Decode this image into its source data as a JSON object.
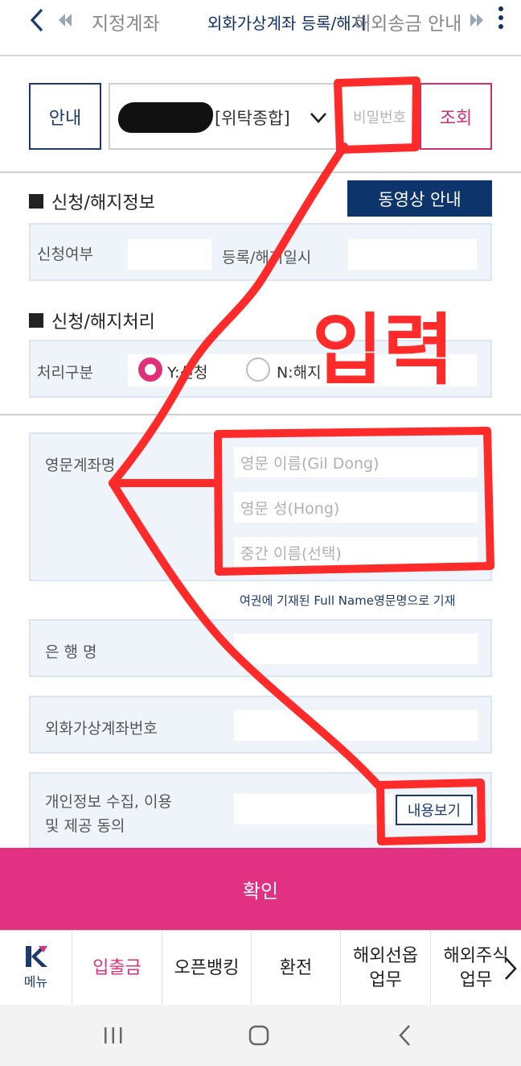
{
  "topnav": {
    "tabs": [
      {
        "label": "지정계좌"
      },
      {
        "label": "외화가상계좌 등록/해지"
      },
      {
        "label": "해외송금 안내"
      }
    ]
  },
  "account": {
    "info_label": "안내",
    "account_type": "[위탁종합]",
    "password_placeholder": "비밀번호",
    "query_label": "조회"
  },
  "section1": {
    "title": "신청/해지정보",
    "video_label": "동영상 안내",
    "apply_label": "신청여부",
    "datetime_label": "등록/해지일시"
  },
  "section2": {
    "title": "신청/해지처리",
    "process_label": "처리구분",
    "options": [
      {
        "label": "Y:신청",
        "selected": true
      },
      {
        "label": "N:해지",
        "selected": false
      }
    ]
  },
  "form": {
    "eng_name_label": "영문계좌명",
    "first_name_placeholder": "영문 이름(Gil Dong)",
    "last_name_placeholder": "영문 성(Hong)",
    "middle_name_placeholder": "중간 이름(선택)",
    "note": "여권에 기재된 Full Name영문명으로 기재",
    "bank_label": "은 행 명",
    "virtual_account_label": "외화가상계좌번호",
    "consent_label_line1": "개인정보 수집, 이용",
    "consent_label_line2": "및 제공 동의",
    "view_label": "내용보기"
  },
  "confirm_label": "확인",
  "bottom_menu": {
    "menu_label": "메뉴",
    "items": [
      {
        "line1": "입출금",
        "line2": ""
      },
      {
        "line1": "오픈뱅킹",
        "line2": ""
      },
      {
        "line1": "환전",
        "line2": ""
      },
      {
        "line1": "해외선옵",
        "line2": "업무"
      },
      {
        "line1": "해외주식",
        "line2": "업무"
      }
    ]
  },
  "annotation": {
    "text": "입력",
    "color": "#ff2a2a"
  },
  "colors": {
    "navy": "#0e356b",
    "pink": "#e23083",
    "panel": "#eef4f9"
  }
}
